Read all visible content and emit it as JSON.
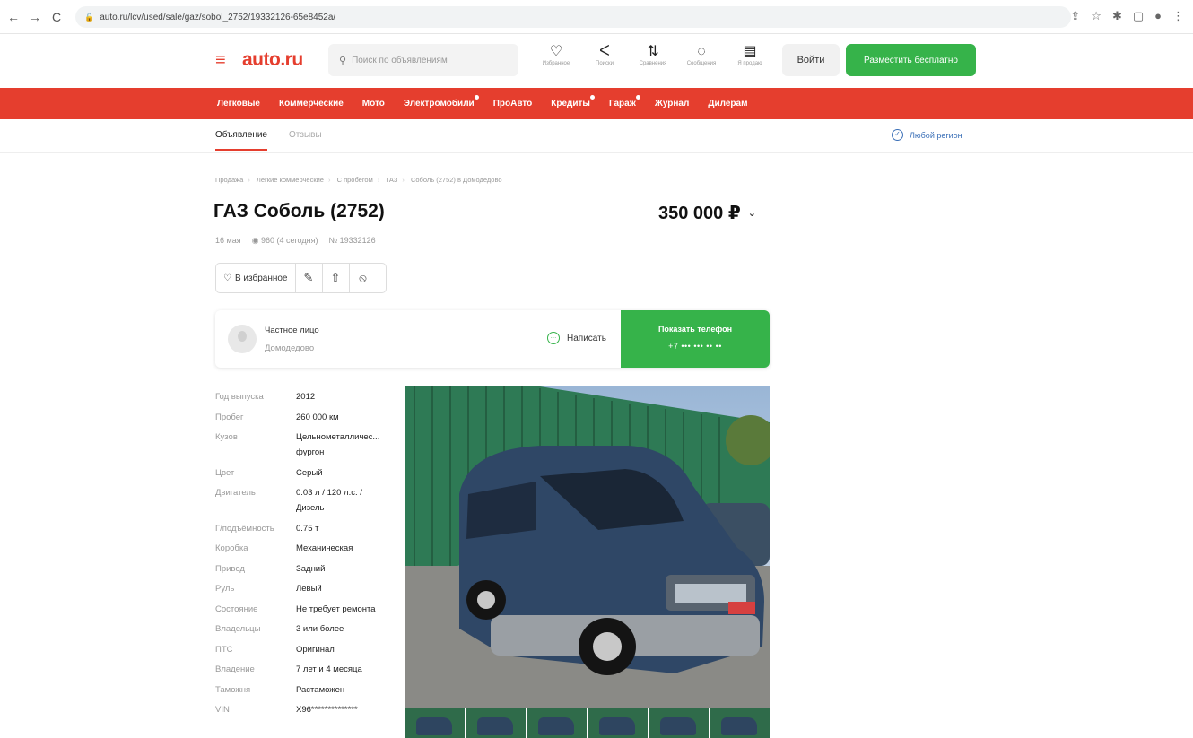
{
  "browser": {
    "url": "auto.ru/lcv/used/sale/gaz/sobol_2752/19332126-65e8452a/"
  },
  "header": {
    "logo": "auto.ru",
    "search_placeholder": "Поиск по объявлениям",
    "icons": [
      {
        "icon": "heart-icon",
        "label": "Избранное"
      },
      {
        "icon": "search-history-icon",
        "label": "Поиски"
      },
      {
        "icon": "compare-icon",
        "label": "Сравнения"
      },
      {
        "icon": "chat-icon",
        "label": "Сообщения"
      },
      {
        "icon": "sell-icon",
        "label": "Я продаю"
      }
    ],
    "login_label": "Войти",
    "post_label": "Разместить бесплатно"
  },
  "nav": {
    "items": [
      "Легковые",
      "Коммерческие",
      "Мото",
      "Электромобили",
      "ПроАвто",
      "Кредиты",
      "Гараж",
      "Журнал",
      "Дилерам"
    ]
  },
  "subtabs": {
    "ad": "Объявление",
    "reviews": "Отзывы",
    "region": "Любой регион"
  },
  "breadcrumbs": [
    "Продажа",
    "Лёгкие коммерческие",
    "С пробегом",
    "ГАЗ",
    "Соболь (2752) в Домодедово"
  ],
  "listing": {
    "title": "ГАЗ Соболь (2752)",
    "price": "350 000 ₽",
    "date": "16 мая",
    "views": "960 (4 сегодня)",
    "id": "№ 19332126",
    "favorite_label": "В избранное"
  },
  "seller": {
    "name": "Частное лицо",
    "city": "Домодедово",
    "write_label": "Написать",
    "phone_label": "Показать телефон",
    "phone_masked": "+7 ••• ••• •• ••"
  },
  "specs": [
    {
      "k": "Год выпуска",
      "v": "2012"
    },
    {
      "k": "Пробег",
      "v": "260 000 км"
    },
    {
      "k": "Кузов",
      "v": "Цельнометалличес... фургон"
    },
    {
      "k": "Цвет",
      "v": "Серый"
    },
    {
      "k": "Двигатель",
      "v": "0.03 л / 120 л.с. / Дизель"
    },
    {
      "k": "Г/подъёмность",
      "v": "0.75 т"
    },
    {
      "k": "Коробка",
      "v": "Механическая"
    },
    {
      "k": "Привод",
      "v": "Задний"
    },
    {
      "k": "Руль",
      "v": "Левый"
    },
    {
      "k": "Состояние",
      "v": "Не требует ремонта"
    },
    {
      "k": "Владельцы",
      "v": "3 или более"
    },
    {
      "k": "ПТС",
      "v": "Оригинал"
    },
    {
      "k": "Владение",
      "v": "7 лет и 4 месяца"
    },
    {
      "k": "Таможня",
      "v": "Растаможен"
    },
    {
      "k": "VIN",
      "v": "X96**************"
    }
  ],
  "colors": {
    "brand_red": "#e53e2e",
    "green": "#36b34a",
    "link_blue": "#3a6fb7"
  }
}
